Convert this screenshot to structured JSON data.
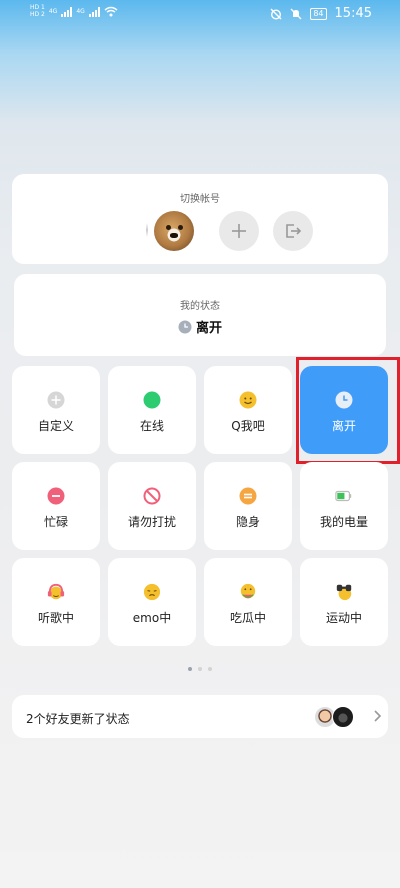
{
  "status_bar": {
    "sim1": "HD 1",
    "sim2": "HD 2",
    "net1": "4G",
    "net2": "4G",
    "battery": "84",
    "time": "15:45"
  },
  "account_switch": {
    "title": "切换帐号",
    "add_icon": "plus-icon",
    "exit_icon": "exit-icon"
  },
  "my_status": {
    "title": "我的状态",
    "current": "离开",
    "icon": "clock-icon"
  },
  "status_tiles": [
    {
      "label": "自定义",
      "icon": "plus-circle-icon",
      "color": "#cfcfcf"
    },
    {
      "label": "在线",
      "icon": "online-dot-icon",
      "color": "#2ecc71"
    },
    {
      "label": "Q我吧",
      "icon": "smile-icon",
      "color": "#f5c02e"
    },
    {
      "label": "离开",
      "icon": "clock-icon",
      "color": "#ffffff",
      "active": true
    },
    {
      "label": "忙碌",
      "icon": "busy-icon",
      "color": "#f0607a"
    },
    {
      "label": "请勿打扰",
      "icon": "do-not-disturb-icon",
      "color": "#f0607a"
    },
    {
      "label": "隐身",
      "icon": "invisible-icon",
      "color": "#f5a640"
    },
    {
      "label": "我的电量",
      "icon": "battery-icon",
      "color": "#3fc15a"
    },
    {
      "label": "听歌中",
      "icon": "headphones-emoji-icon",
      "color": "#f0607a"
    },
    {
      "label": "emo中",
      "icon": "sad-emoji-icon",
      "color": "#f5c02e"
    },
    {
      "label": "吃瓜中",
      "icon": "eating-melon-emoji-icon",
      "color": "#f5c02e"
    },
    {
      "label": "运动中",
      "icon": "sports-emoji-icon",
      "color": "#f5c02e"
    }
  ],
  "pagination": {
    "pages": 3,
    "current": 1
  },
  "friends_update": {
    "text": "2个好友更新了状态",
    "chevron_icon": "chevron-right-icon"
  },
  "colors": {
    "accent": "#409cf9",
    "highlight": "#e0202a"
  }
}
